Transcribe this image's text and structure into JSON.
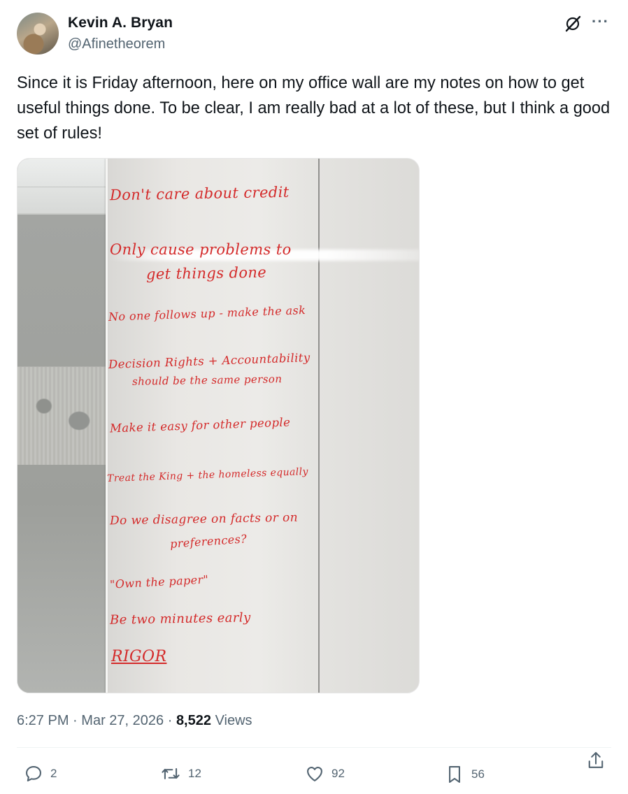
{
  "author": {
    "name": "Kevin A. Bryan",
    "handle": "@Afinetheorem"
  },
  "tweet": {
    "text": "Since it is Friday afternoon, here on my office wall are my notes on how to get useful things done. To be clear, I am really bad at a lot of these, but I think a good set of rules!"
  },
  "photo": {
    "notes": [
      "Don't care about credit",
      "Only cause problems to",
      "get things done",
      "No one follows up - make the ask",
      "Decision Rights + Accountability",
      "should be the same person",
      "Make it easy for other people",
      "Treat the King + the homeless equally",
      "Do we disagree on facts or on",
      "preferences?",
      "\"Own the paper\"",
      "Be two minutes early",
      "RIGOR"
    ],
    "ink_color": "#d42a2a"
  },
  "meta": {
    "time": "6:27 PM",
    "separator": "·",
    "date": "Mar 27, 2026",
    "views_count": "8,522",
    "views_label": "Views"
  },
  "actions": {
    "replies": "2",
    "reposts": "12",
    "likes": "92",
    "bookmarks": "56"
  },
  "icons": {
    "grok": "grok-icon",
    "more": "more-icon",
    "reply": "reply-icon",
    "repost": "repost-icon",
    "like": "heart-icon",
    "bookmark": "bookmark-icon",
    "share": "share-icon"
  },
  "colors": {
    "text": "#0f1419",
    "secondary": "#536471"
  }
}
